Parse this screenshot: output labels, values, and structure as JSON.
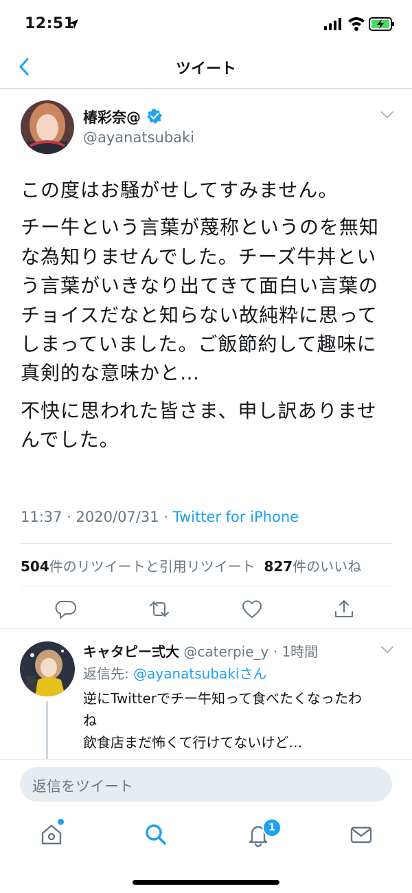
{
  "status_bar": {
    "time": "12:51"
  },
  "nav": {
    "title": "ツイート"
  },
  "tweet": {
    "author_name": "椿彩奈@",
    "handle": "@ayanatsubaki",
    "paragraphs": [
      "この度はお騒がせしてすみません。",
      "チー牛という言葉が蔑称というのを無知な為知りませんでした。チーズ牛丼という言葉がいきなり出てきて面白い言葉のチョイスだなと知らない故純粋に思ってしまっていました。ご飯節約して趣味に真剣的な意味かと…",
      "不快に思われた皆さま、申し訳ありませんでした。"
    ],
    "timestamp": "11:37 · 2020/07/31 · ",
    "client": "Twitter for iPhone",
    "retweet_count": "504",
    "retweet_label": "件のリツイートと引用リツイート",
    "like_count": "827",
    "like_label": "件のいいね"
  },
  "reply": {
    "author_name": "キャタピー弍大",
    "handle_time": " @caterpie_y · 1時間",
    "reply_to_prefix": "返信先: ",
    "reply_to_handle": "@ayanatsubaki",
    "reply_to_suffix": "さん",
    "lines": [
      "逆にTwitterでチー牛知って食べたくなったわ",
      "ね",
      "飲食店まだ怖くて行けてないけど…"
    ]
  },
  "reply_bar": {
    "placeholder": "返信をツイート"
  },
  "tab_bar": {
    "notification_badge": "1"
  },
  "icons": {
    "back": "chevron-left-icon",
    "verified": "verified-badge-icon",
    "reply": "reply-icon",
    "retweet": "retweet-icon",
    "like": "heart-icon",
    "share": "share-icon",
    "home": "home-icon",
    "search": "search-icon",
    "notifications": "bell-icon",
    "messages": "mail-icon"
  },
  "colors": {
    "accent": "#1da1f2",
    "secondary_text": "#657786",
    "battery": "#4cd964"
  }
}
